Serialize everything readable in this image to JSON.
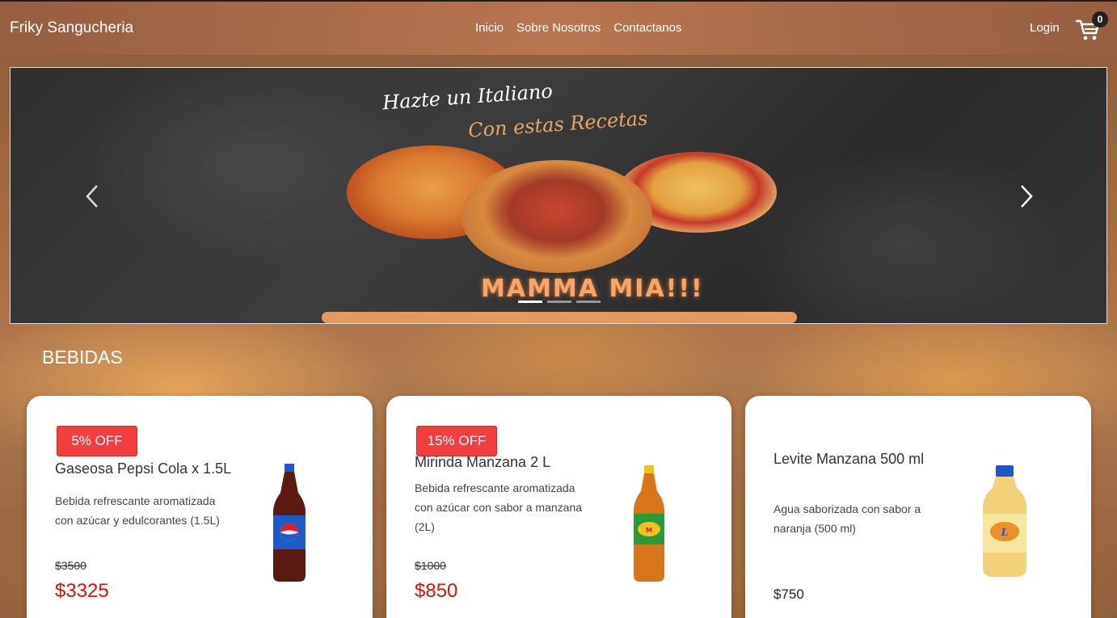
{
  "header": {
    "brand": "Friky Sangucheria",
    "nav": [
      "Inicio",
      "Sobre Nosotros",
      "Contactanos"
    ],
    "login": "Login",
    "cart_count": "0"
  },
  "carousel": {
    "script_line1": "Hazte un Italiano",
    "script_line2": "Con estas Recetas",
    "caption": "MAMMA MIA!!!",
    "slides_count": 3,
    "active_slide": 1
  },
  "section": {
    "title": "BEBIDAS"
  },
  "products": [
    {
      "badge": "5% OFF",
      "name": "Gaseosa Pepsi Cola x 1.5L",
      "description": "Bebida refrescante aromatizada con azúcar y edulcorantes (1.5L)",
      "old_price": "$3500",
      "price": "$3325"
    },
    {
      "badge": "15% OFF",
      "name": "Mirinda Manzana 2 L",
      "description": "Bebida refrescante aromatizada con azúcar con sabor a manzana (2L)",
      "old_price": "$1000",
      "price": "$850"
    },
    {
      "name": "Levite Manzana 500 ml",
      "description": "Agua saborizada con sabor a naranja (500 ml)",
      "price": "$750"
    }
  ]
}
